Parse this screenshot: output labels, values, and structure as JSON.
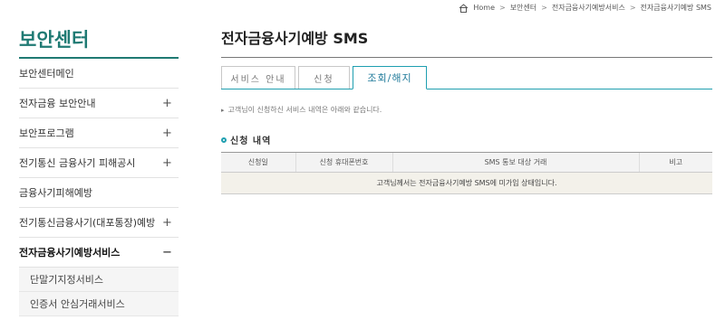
{
  "breadcrumb": {
    "icon": "home-icon",
    "items": [
      "Home",
      "보안센터",
      "전자금융사기예방서비스",
      "전자금융사기예방 SMS"
    ],
    "separator": ">"
  },
  "sidebar": {
    "title": "보안센터",
    "items": [
      {
        "label": "보안센터메인",
        "toggle": ""
      },
      {
        "label": "전자금융 보안안내",
        "toggle": "+"
      },
      {
        "label": "보안프로그램",
        "toggle": "+"
      },
      {
        "label": "전기통신 금융사기 피해공시",
        "toggle": "+"
      },
      {
        "label": "금융사기피해예방",
        "toggle": ""
      },
      {
        "label": "전기통신금융사기(대포통장)예방",
        "toggle": "+"
      },
      {
        "label": "전자금융사기예방서비스",
        "toggle": "−"
      }
    ],
    "sub_items": [
      "단말기지정서비스",
      "인증서 안심거래서비스"
    ]
  },
  "main": {
    "title": "전자금융사기예방 SMS",
    "tabs": [
      {
        "label": "서비스 안내",
        "active": false
      },
      {
        "label": "신청",
        "active": false
      },
      {
        "label": "조회/해지",
        "active": true
      }
    ],
    "description": "고객님이 신청하신 서비스 내역은 아래와 같습니다.",
    "section_title": "신청 내역",
    "table": {
      "headers": [
        "신청일",
        "신청 휴대폰번호",
        "SMS 통보 대상 거래",
        "비고"
      ],
      "empty_message": "고객님께서는 전자금융사기예방 SMS에 미가입 상태입니다."
    }
  },
  "colors": {
    "accent": "#1f7a73",
    "tab_accent": "#1f9fb0"
  }
}
